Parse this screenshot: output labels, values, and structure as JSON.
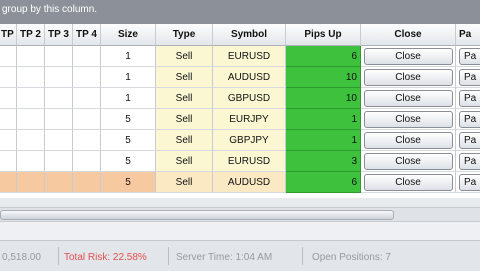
{
  "group_hint": "group by this column.",
  "columns": {
    "tp1": "TP 1",
    "tp2": "TP 2",
    "tp3": "TP 3",
    "tp4": "TP 4",
    "size": "Size",
    "type": "Type",
    "symbol": "Symbol",
    "pips_up": "Pips Up",
    "close": "Close",
    "pa": "Pa"
  },
  "rows": [
    {
      "size": "1",
      "type": "Sell",
      "symbol": "EURUSD",
      "pips": "6",
      "close": "Close",
      "pa": "Pa"
    },
    {
      "size": "1",
      "type": "Sell",
      "symbol": "AUDUSD",
      "pips": "10",
      "close": "Close",
      "pa": "Pa"
    },
    {
      "size": "1",
      "type": "Sell",
      "symbol": "GBPUSD",
      "pips": "10",
      "close": "Close",
      "pa": "Pa"
    },
    {
      "size": "5",
      "type": "Sell",
      "symbol": "EURJPY",
      "pips": "1",
      "close": "Close",
      "pa": "Pa"
    },
    {
      "size": "5",
      "type": "Sell",
      "symbol": "GBPJPY",
      "pips": "1",
      "close": "Close",
      "pa": "Pa"
    },
    {
      "size": "5",
      "type": "Sell",
      "symbol": "EURUSD",
      "pips": "3",
      "close": "Close",
      "pa": "Pa"
    },
    {
      "size": "5",
      "type": "Sell",
      "symbol": "AUDUSD",
      "pips": "6",
      "close": "Close",
      "pa": "Pa"
    }
  ],
  "status": {
    "balance": "0,518.00",
    "total_risk": "Total Risk: 22.58%",
    "server_time": "Server Time: 1:04 AM",
    "open_positions": "Open Positions: 7"
  },
  "colors": {
    "pips_positive": "#3ec23e",
    "selected_row": "#f6c9a0",
    "type_symbol_bg": "#fbf7d3",
    "risk_text": "#e34040"
  }
}
